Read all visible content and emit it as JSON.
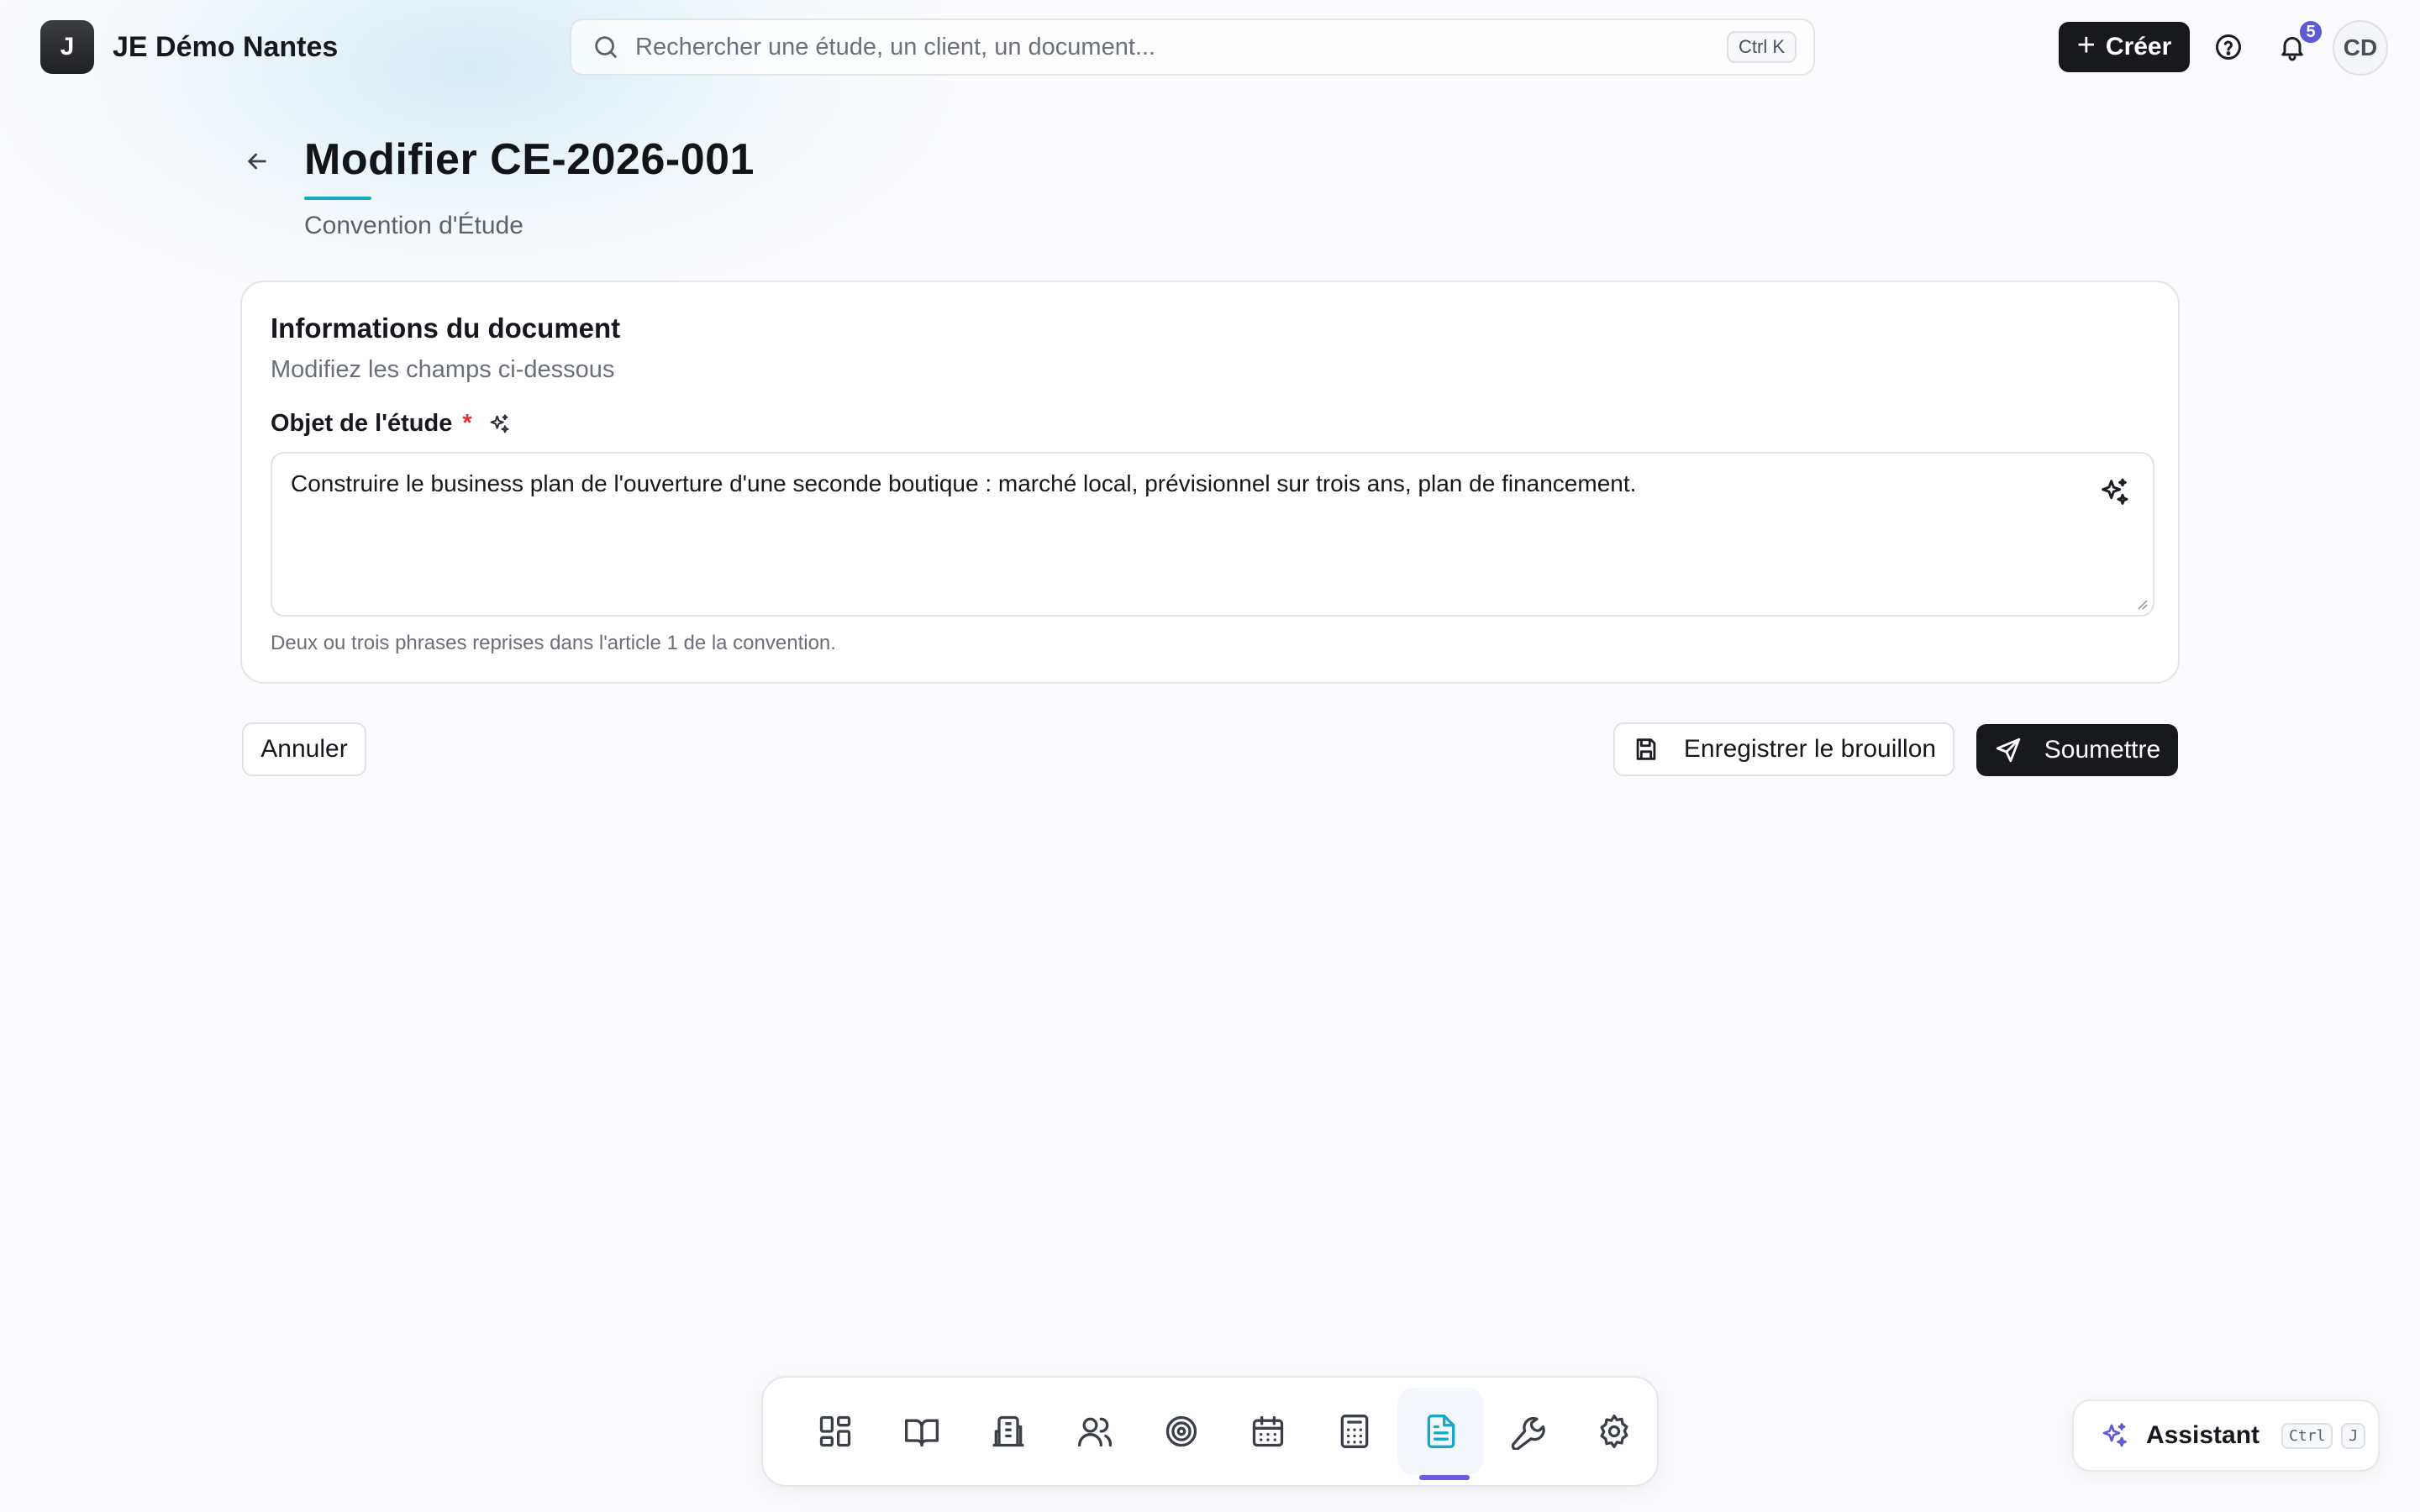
{
  "app": {
    "logo_letter": "J",
    "name": "JE Démo Nantes"
  },
  "search": {
    "placeholder": "Rechercher une étude, un client, un document...",
    "shortcut": "Ctrl K"
  },
  "header_actions": {
    "create_label": "Créer",
    "notification_count": "5",
    "avatar_initials": "CD"
  },
  "page": {
    "title": "Modifier CE-2026-001",
    "subtitle": "Convention d'Étude"
  },
  "card": {
    "title": "Informations du document",
    "description": "Modifiez les champs ci-dessous",
    "field": {
      "label": "Objet de l'étude",
      "required_mark": "*",
      "value": "Construire le business plan de l'ouverture d'une seconde boutique : marché local, prévisionnel sur trois ans, plan de financement.",
      "hint": "Deux ou trois phrases reprises dans l'article 1 de la convention."
    }
  },
  "actions": {
    "cancel": "Annuler",
    "save_draft": "Enregistrer le brouillon",
    "submit": "Soumettre"
  },
  "dock": {
    "items": [
      {
        "icon": "dashboard-icon"
      },
      {
        "icon": "book-icon"
      },
      {
        "icon": "building-icon"
      },
      {
        "icon": "users-icon"
      },
      {
        "icon": "target-icon"
      },
      {
        "icon": "calendar-icon"
      },
      {
        "icon": "calculator-icon"
      },
      {
        "icon": "document-icon",
        "active": true
      },
      {
        "icon": "wrench-icon"
      },
      {
        "icon": "settings-icon"
      }
    ],
    "active_color": "#19a8c4",
    "indicator_color": "#6a5be0"
  },
  "assistant": {
    "label": "Assistant",
    "shortcut_keys": [
      "Ctrl",
      "J"
    ]
  }
}
